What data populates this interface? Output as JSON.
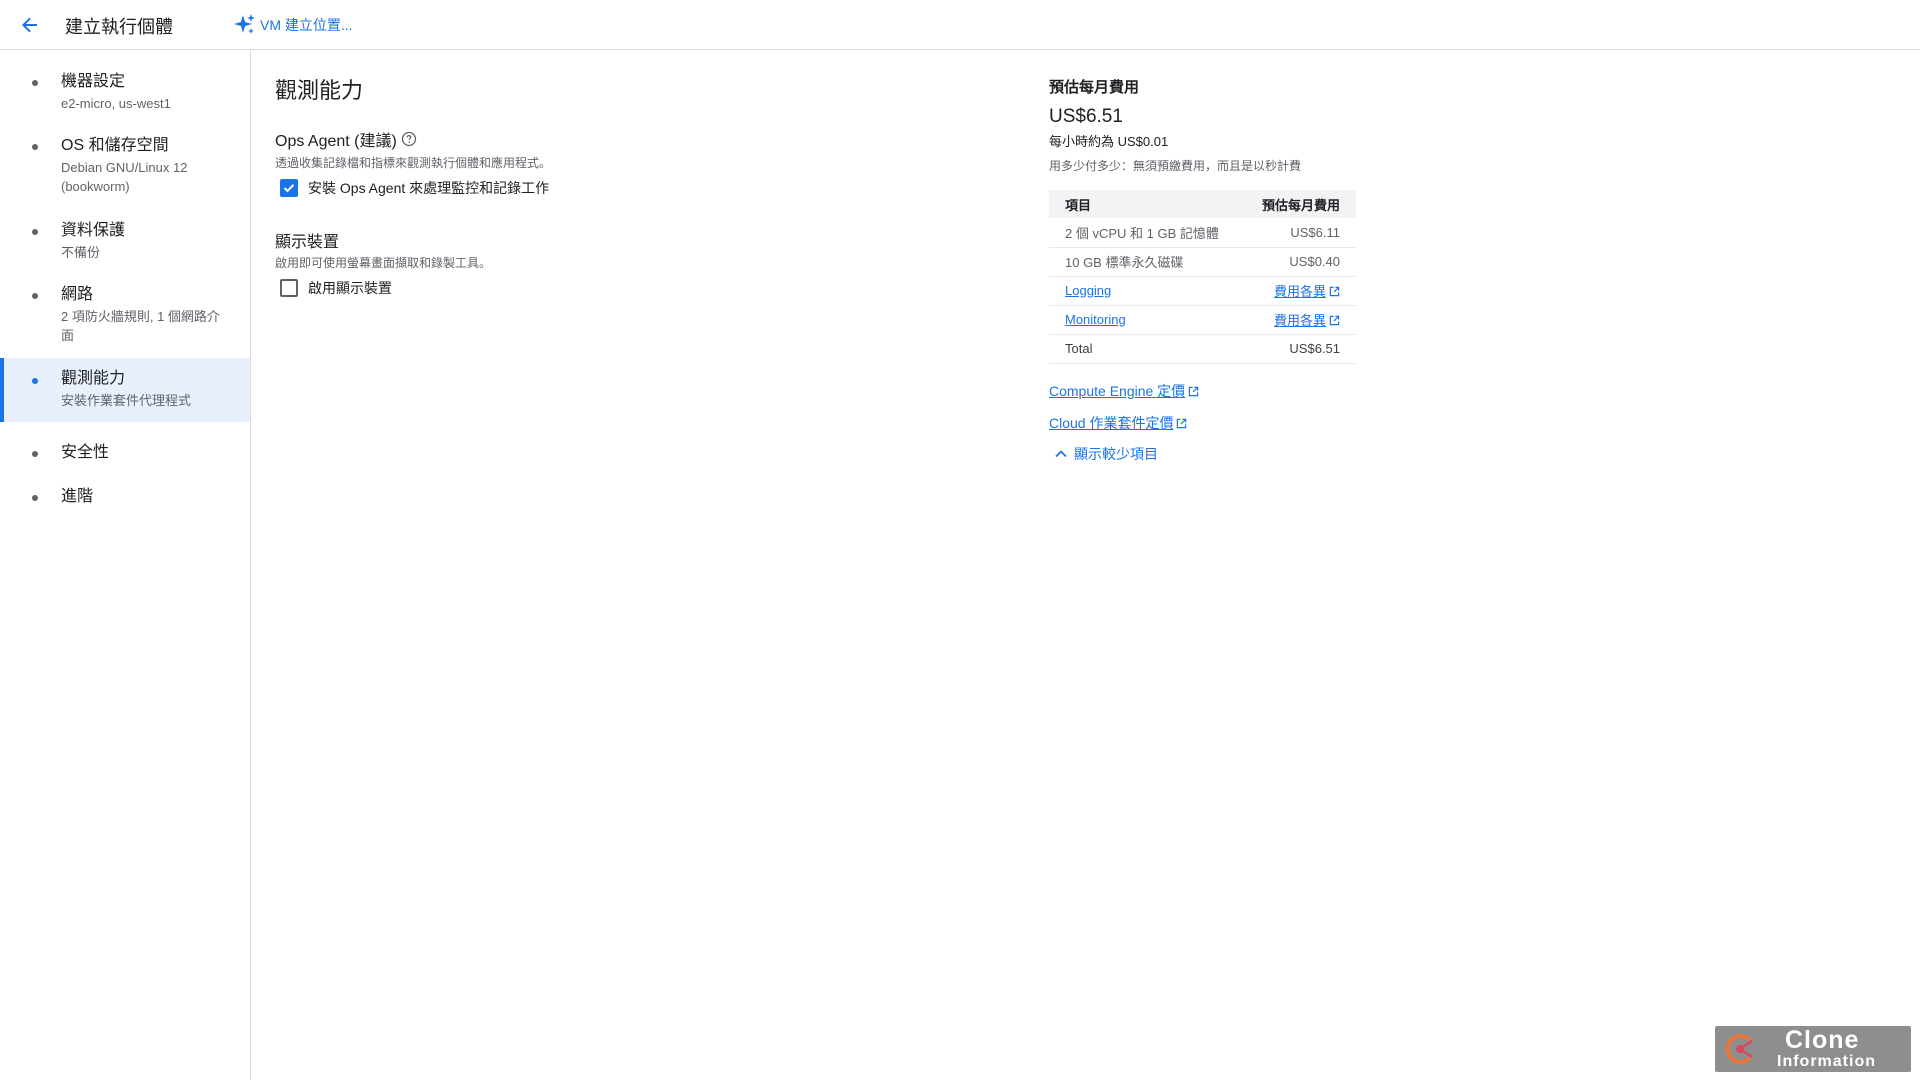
{
  "header": {
    "title": "建立執行個體",
    "ai_button_label": "VM 建立位置..."
  },
  "sidebar": {
    "items": [
      {
        "label": "機器設定",
        "sub": "e2-micro, us-west1"
      },
      {
        "label": "OS 和儲存空間",
        "sub": "Debian GNU/Linux 12 (bookworm)"
      },
      {
        "label": "資料保護",
        "sub": "不備份"
      },
      {
        "label": "網路",
        "sub": "2 項防火牆規則, 1 個網路介面"
      },
      {
        "label": "觀測能力",
        "sub": "安裝作業套件代理程式"
      },
      {
        "label": "安全性",
        "sub": ""
      },
      {
        "label": "進階",
        "sub": ""
      }
    ]
  },
  "main": {
    "title": "觀測能力",
    "ops_agent": {
      "title": "Ops Agent (建議)",
      "description": "透過收集記錄檔和指標來觀測執行個體和應用程式。",
      "checkbox_label": "安裝 Ops Agent 來處理監控和記錄工作",
      "checked": true
    },
    "display": {
      "title": "顯示裝置",
      "description": "啟用即可使用螢幕畫面擷取和錄製工具。",
      "checkbox_label": "啟用顯示裝置",
      "checked": false
    }
  },
  "cost": {
    "title": "預估每月費用",
    "price": "US$6.51",
    "hourly": "每小時約為 US$0.01",
    "note": "用多少付多少：無須預繳費用，而且是以秒計費",
    "table": {
      "header_item": "項目",
      "header_cost": "預估每月費用",
      "rows": [
        {
          "item": "2 個 vCPU 和 1 GB 記憶體",
          "cost": "US$6.11"
        },
        {
          "item": "10 GB 標準永久磁碟",
          "cost": "US$0.40"
        },
        {
          "item": "Logging",
          "cost": "費用各異"
        },
        {
          "item": "Monitoring",
          "cost": "費用各異"
        },
        {
          "item": "Total",
          "cost": "US$6.51"
        }
      ]
    },
    "links": {
      "compute_engine": "Compute Engine 定價",
      "cloud_ops": "Cloud 作業套件定價",
      "show_less": "顯示較少項目"
    }
  },
  "watermark": {
    "line1": "Clone",
    "line2": "Information"
  },
  "colors": {
    "accent": "#1a73e8",
    "active_bg": "#e8f0fe",
    "border": "#dadce0",
    "text_secondary": "#5f6368"
  }
}
